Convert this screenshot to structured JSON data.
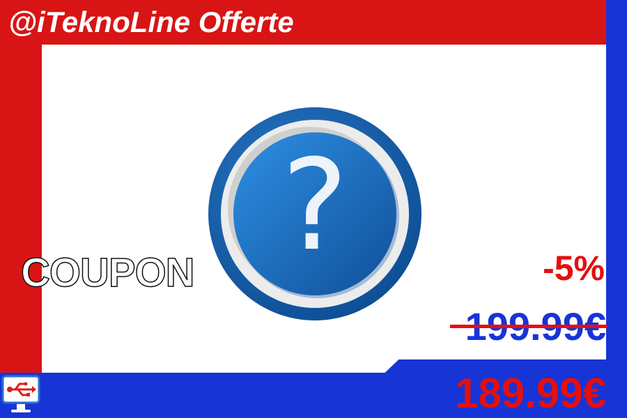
{
  "header": {
    "title": "@iTeknoLine Offerte"
  },
  "product": {
    "icon": "question-mark-icon",
    "coupon_label": "COUPON",
    "discount": "-5%",
    "old_price": "199.99€",
    "new_price": "189.99€"
  },
  "logo": {
    "icon": "usb-computer-icon"
  },
  "colors": {
    "red": "#d91414",
    "blue": "#1734d6",
    "price_red": "#e50f0f"
  }
}
